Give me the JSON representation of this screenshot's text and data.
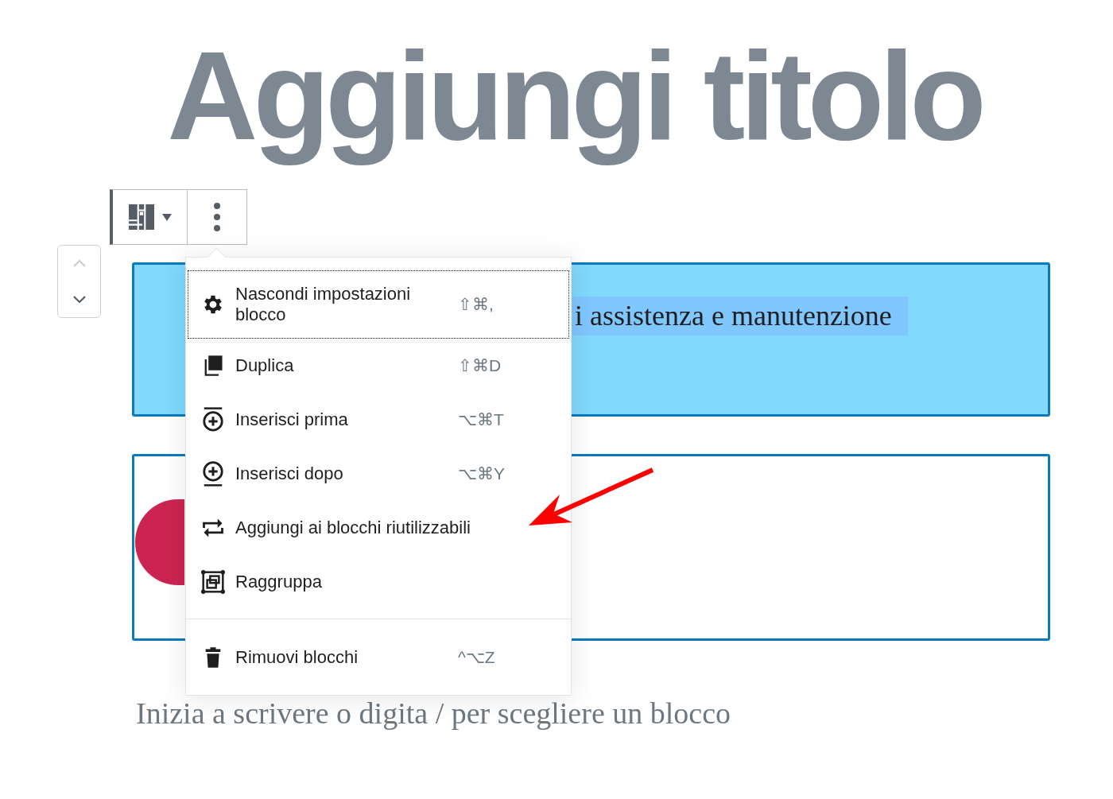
{
  "title": "Aggiungi titolo",
  "mover": [
    {
      "disabled": true
    },
    {
      "disabled": false
    }
  ],
  "blocks": [
    {
      "kind": "highlighted",
      "text": "i assistenza e manutenzione"
    },
    {
      "kind": "media"
    }
  ],
  "placeholder": "Inizia a scrivere o digita / per scegliere un blocco",
  "menu": {
    "groups": [
      [
        {
          "label": "Nascondi impostazioni blocco",
          "shortcut": "⇧⌘,",
          "focused": true
        },
        {
          "label": "Duplica",
          "shortcut": "⇧⌘D",
          "focused": false
        },
        {
          "label": "Inserisci prima",
          "shortcut": "⌥⌘T",
          "focused": false
        },
        {
          "label": "Inserisci dopo",
          "shortcut": "⌥⌘Y",
          "focused": false
        },
        {
          "label": "Aggiungi ai blocchi riutilizzabili",
          "focused": false
        },
        {
          "label": "Raggruppa",
          "focused": false
        }
      ],
      [
        {
          "label": "Rimuovi blocchi",
          "shortcut": "^⌥Z",
          "focused": false
        }
      ]
    ]
  }
}
